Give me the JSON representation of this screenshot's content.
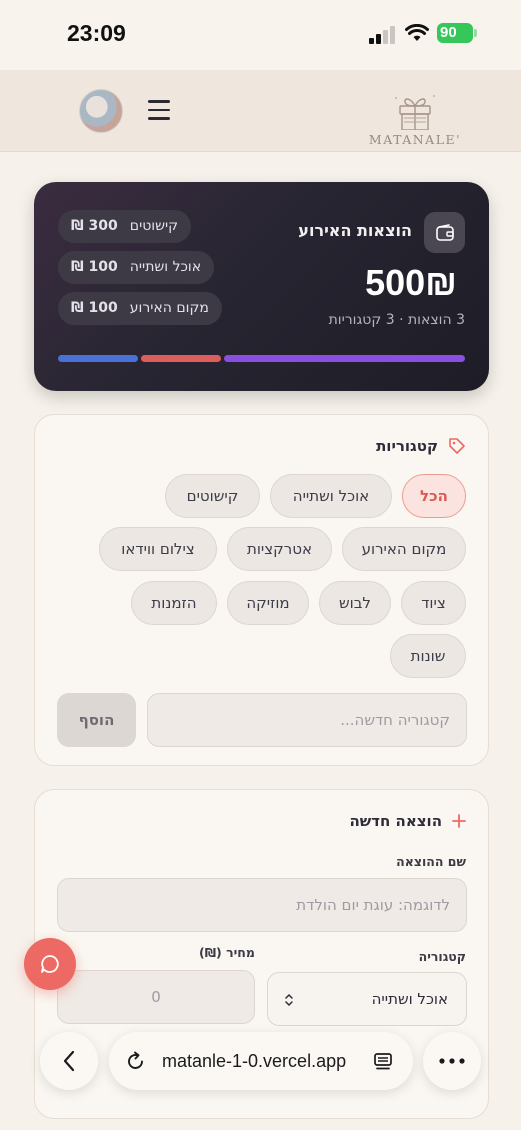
{
  "status_bar": {
    "time": "23:09",
    "battery": "90"
  },
  "header": {
    "logo_text": "MATANALE'"
  },
  "summary": {
    "title": "הוצאות האירוע",
    "amount": "500₪",
    "subtitle": "3 הוצאות · 3 קטגוריות",
    "chips": [
      {
        "label": "קישוטים",
        "amount": "300 ₪"
      },
      {
        "label": "אוכל ושתייה",
        "amount": "100 ₪"
      },
      {
        "label": "מקום האירוע",
        "amount": "100 ₪"
      }
    ],
    "progress_colors": [
      "#4a72d6",
      "#dd5c5c",
      "#8a4fe0"
    ]
  },
  "categories": {
    "title": "קטגוריות",
    "items": [
      "הכל",
      "אוכל ושתייה",
      "קישוטים",
      "מקום האירוע",
      "אטרקציות",
      "צילום ווידאו",
      "ציוד",
      "לבוש",
      "מוזיקה",
      "הזמנות",
      "שונות"
    ],
    "selected": "הכל",
    "new_placeholder": "קטגוריה חדשה...",
    "add_label": "הוסף"
  },
  "new_expense": {
    "title": "הוצאה חדשה",
    "name_label": "שם ההוצאה",
    "name_placeholder": "לדוגמה: עוגת יום הולדת",
    "category_label": "קטגוריה",
    "category_value": "אוכל ושתייה",
    "price_label": "מחיר (₪)",
    "price_placeholder": "0"
  },
  "browser": {
    "url": "matanle-1-0.vercel.app"
  },
  "colors": {
    "accent": "#ec6a63",
    "dark_card": "#272531",
    "background": "#f6f1ea"
  }
}
